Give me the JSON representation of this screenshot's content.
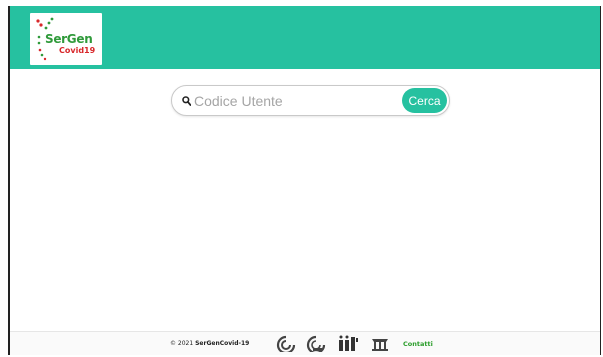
{
  "header": {
    "logo": {
      "line1": "SerGen",
      "line2": "Covid19",
      "icon": "dna-helix-icon"
    }
  },
  "search": {
    "placeholder": "Codice Utente",
    "value": "",
    "button_label": "Cerca",
    "icon": "search-icon"
  },
  "footer": {
    "copyright_prefix": "© 2021",
    "copyright_name": "SerGenCovid-19",
    "partner_logos": [
      "cnr-logo-icon",
      "cnr-iba-logo-icon",
      "iit-logo-icon",
      "isti-logo-icon"
    ],
    "contact_label": "Contatti"
  },
  "colors": {
    "accent": "#26c1a0",
    "contact": "#2a9d2a",
    "logo_green": "#2f9a3a",
    "logo_red": "#d8272a"
  }
}
